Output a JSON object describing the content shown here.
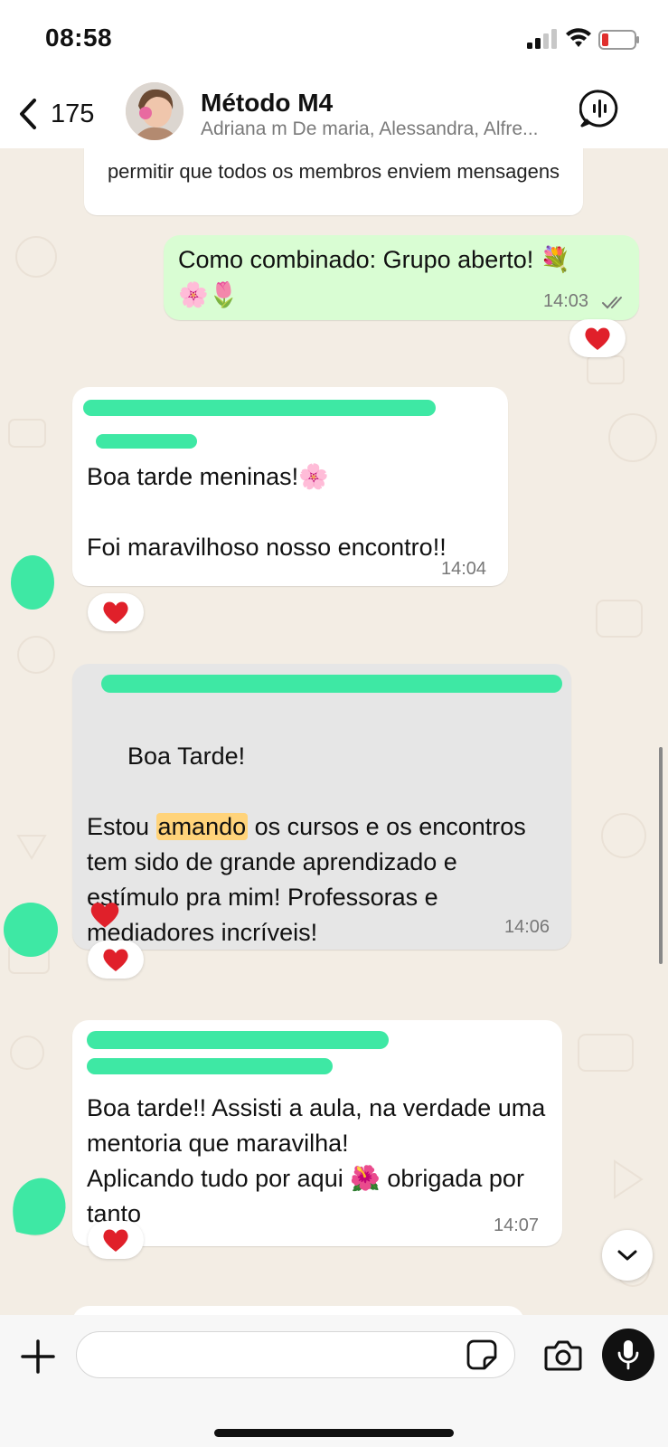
{
  "status_bar": {
    "time": "08:58"
  },
  "header": {
    "back_count": "175",
    "group_name": "Método M4",
    "members": "Adriana m De maria, Alessandra, Alfre..."
  },
  "messages": {
    "system_notice": "permitir que todos os membros enviem mensagens",
    "m1": {
      "text": "Como combinado: Grupo aberto! 💐\n🌸🌷",
      "time": "14:03",
      "reaction": "❤️"
    },
    "m2": {
      "text": "Boa tarde meninas!🌸\n\nFoi maravilhoso nosso encontro!!",
      "time": "14:04",
      "reaction": "❤️"
    },
    "m3": {
      "line1": "Boa Tarde!",
      "pre": "Estou ",
      "highlight": "amando",
      "post": " os cursos e os encontros tem sido de grande aprendizado e estímulo pra mim! Professoras e mediadores incríveis!",
      "time": "14:06",
      "reaction": "❤️"
    },
    "m4": {
      "text": "Boa tarde!! Assisti a aula, na verdade uma mentoria que maravilha!\nAplicando tudo por aqui 🌺 obrigada por tanto",
      "time": "14:07",
      "reaction": "❤️"
    }
  },
  "colors": {
    "outgoing": "#d9fdd3",
    "incoming": "#ffffff",
    "redaction": "#3ee8a4",
    "highlight": "#ffd37a",
    "sender": "#c0395b"
  },
  "icons": [
    "back-chevron-icon",
    "voice-call-icon",
    "plus-icon",
    "sticker-icon",
    "camera-icon",
    "mic-icon",
    "chevron-down-icon",
    "double-check-icon",
    "heart-icon"
  ]
}
